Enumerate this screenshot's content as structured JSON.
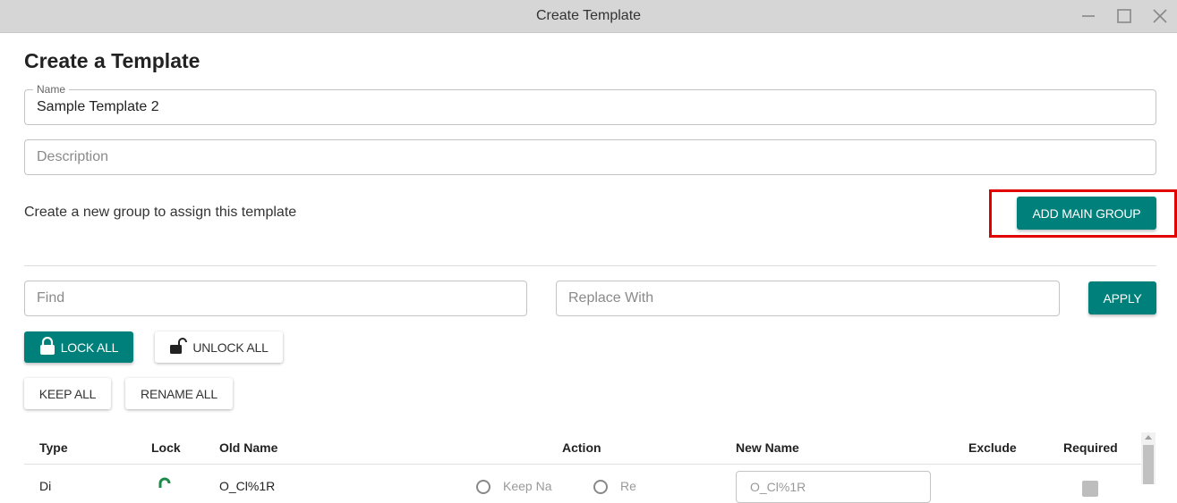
{
  "window": {
    "title": "Create Template"
  },
  "page": {
    "title": "Create a Template"
  },
  "form": {
    "name_label": "Name",
    "name_value": "Sample Template 2",
    "description_placeholder": "Description",
    "helper_text": "Create a new group to assign this template",
    "add_main_group_label": "ADD MAIN GROUP"
  },
  "find_replace": {
    "find_placeholder": "Find",
    "replace_placeholder": "Replace With",
    "apply_label": "APPLY"
  },
  "actions": {
    "lock_all": "LOCK ALL",
    "unlock_all": "UNLOCK ALL",
    "keep_all": "KEEP ALL",
    "rename_all": "RENAME ALL"
  },
  "table": {
    "headers": [
      "Type",
      "Lock",
      "Old Name",
      "Action",
      "New Name",
      "Exclude",
      "Required"
    ],
    "rows": [
      {
        "type": "Di",
        "old_name": "O_Cl%1R",
        "action_keep": "Keep Na",
        "action_rename": "Re",
        "new_name": "O_Cl%1R"
      }
    ]
  },
  "colors": {
    "primary": "#00807a",
    "highlight": "#e00000",
    "titlebar": "#d6d6d6"
  },
  "icons": [
    "minimize-icon",
    "maximize-icon",
    "close-icon",
    "lock-icon",
    "unlock-icon"
  ]
}
